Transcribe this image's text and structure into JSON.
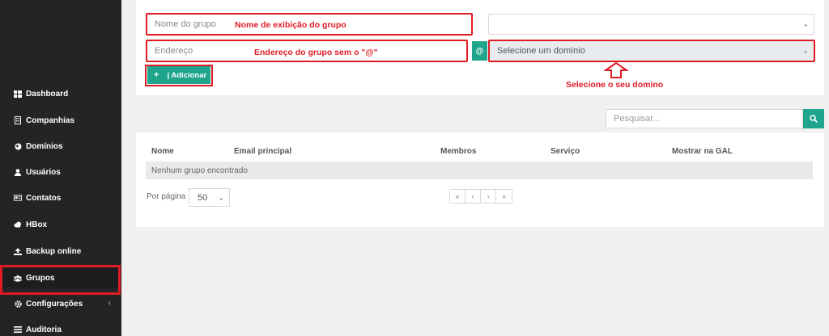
{
  "sidebar": {
    "items": [
      {
        "label": "Dashboard",
        "icon": "dashboard-icon"
      },
      {
        "label": "Companhias",
        "icon": "building-icon"
      },
      {
        "label": "Domínios",
        "icon": "globe-icon"
      },
      {
        "label": "Usuários",
        "icon": "user-icon"
      },
      {
        "label": "Contatos",
        "icon": "contact-card-icon"
      },
      {
        "label": "HBox",
        "icon": "cloud-icon"
      },
      {
        "label": "Backup online",
        "icon": "upload-icon"
      },
      {
        "label": "Grupos",
        "icon": "users-icon"
      },
      {
        "label": "Configurações",
        "icon": "gear-icon"
      },
      {
        "label": "Auditoria",
        "icon": "list-icon"
      }
    ],
    "active": "Grupos"
  },
  "form": {
    "group_name_placeholder": "Nome do grupo",
    "address_placeholder": "Endereço",
    "at_symbol": "@",
    "domain_select_value": "Selecione um domínio",
    "add_button_label": "| Adicionar",
    "add_button_icon": "+"
  },
  "annotations": {
    "group_name": "Nome de exibição do grupo",
    "address": "Endereço do grupo sem o \"@\"",
    "domain": "Selecione o seu domino"
  },
  "search": {
    "placeholder": "Pesquisar..."
  },
  "table": {
    "columns": [
      "Nome",
      "Email principal",
      "Membros",
      "Serviço",
      "Mostrar na GAL"
    ],
    "empty_message": "Nenhum grupo encontrado"
  },
  "pagination": {
    "per_page_label": "Por página",
    "per_page_value": "50",
    "buttons": [
      "«",
      "‹",
      "›",
      "»"
    ]
  },
  "colors": {
    "accent": "#1fa58c",
    "annotation": "#e01b24",
    "sidebar_bg": "#232425"
  }
}
